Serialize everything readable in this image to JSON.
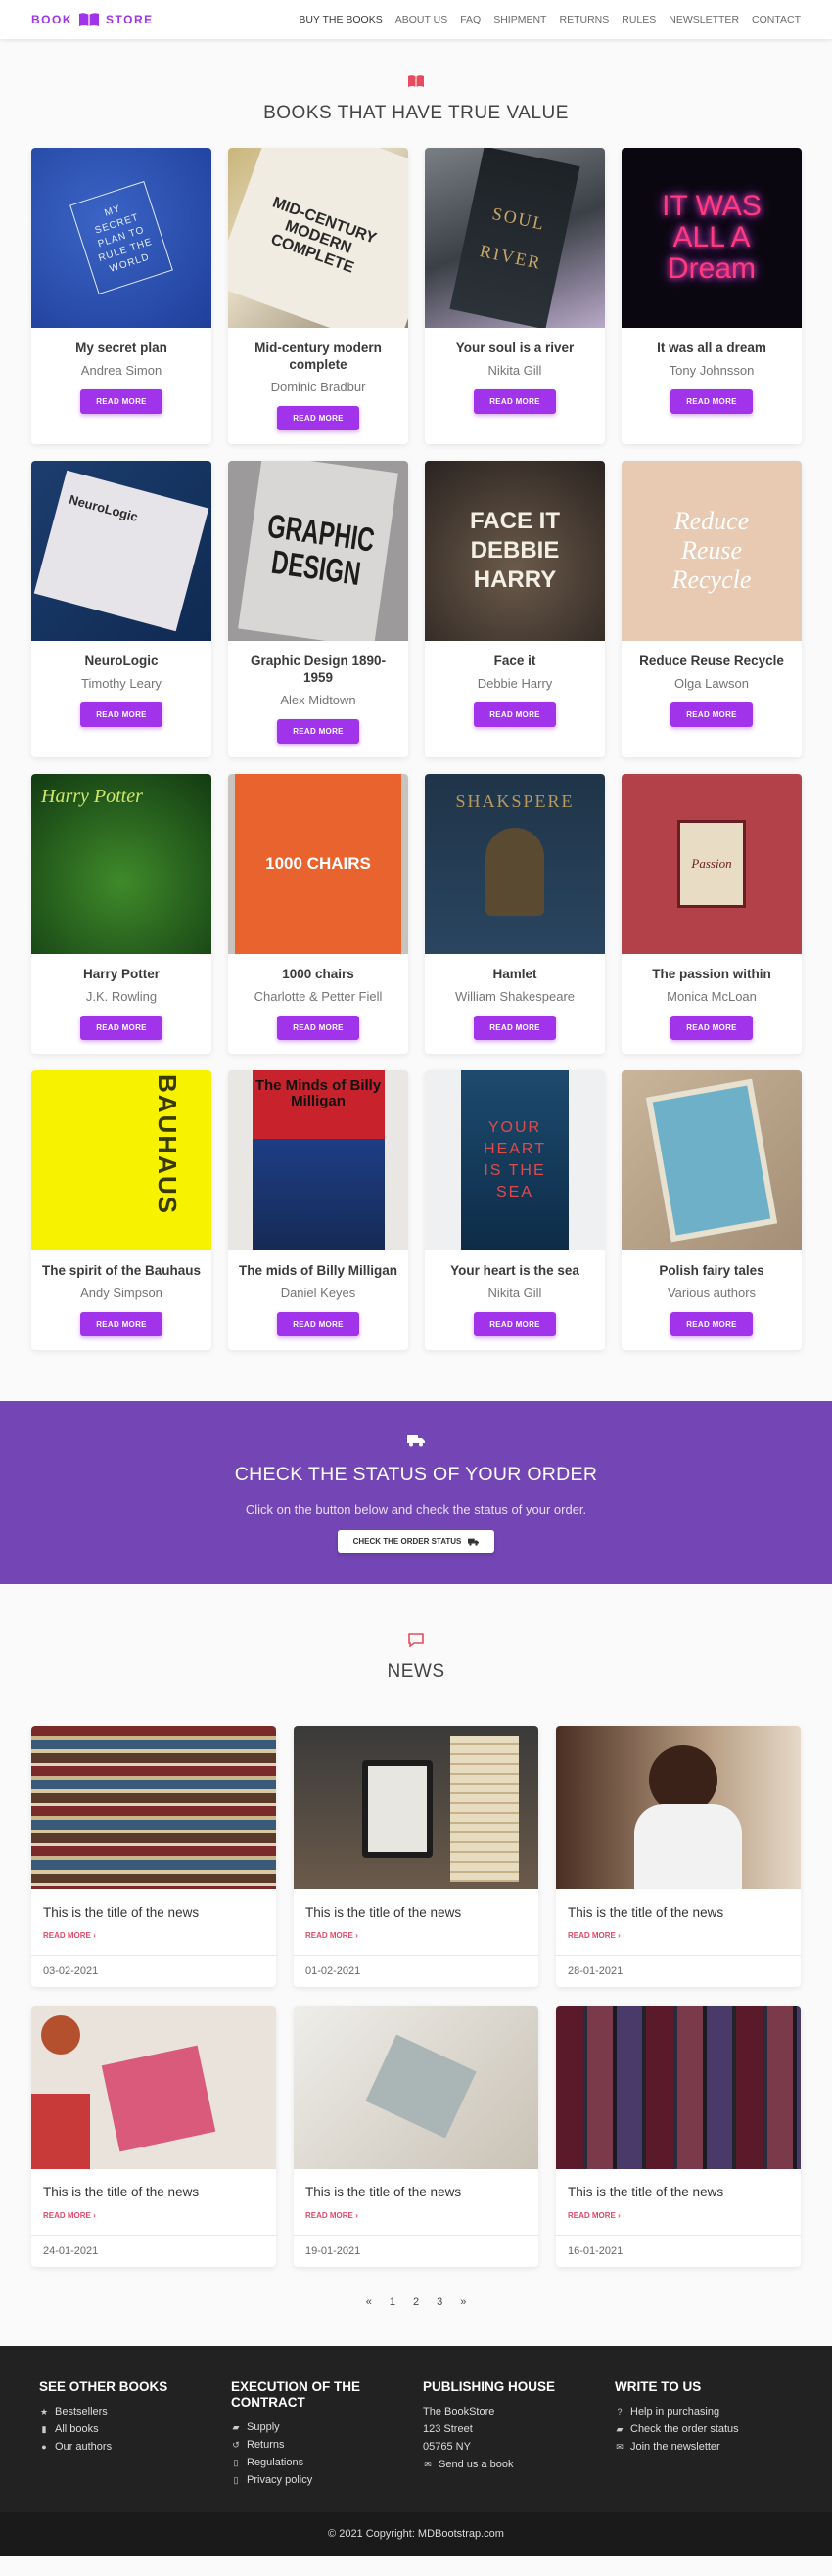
{
  "nav": {
    "brand_left": "BOOK",
    "brand_right": "STORE",
    "items": [
      "BUY THE BOOKS",
      "ABOUT US",
      "FAQ",
      "SHIPMENT",
      "RETURNS",
      "RULES",
      "NEWSLETTER",
      "CONTACT"
    ]
  },
  "books_section": {
    "title": "BOOKS THAT HAVE TRUE VALUE",
    "read_more": "READ MORE",
    "books": [
      {
        "title": "My secret plan",
        "author": "Andrea Simon",
        "cover_text": "MY SECRET PLAN TO RULE THE WORLD"
      },
      {
        "title": "Mid-century modern complete",
        "author": "Dominic Bradbur",
        "cover_text": "MID-CENTURY MODERN COMPLETE"
      },
      {
        "title": "Your soul is a river",
        "author": "Nikita Gill",
        "cover_text": "SOUL RIVER"
      },
      {
        "title": "It was all a dream",
        "author": "Tony Johnsson",
        "cover_text": "IT WAS ALL A Dream"
      },
      {
        "title": "NeuroLogic",
        "author": "Timothy Leary",
        "cover_text": "NeuroLogic"
      },
      {
        "title": "Graphic Design 1890-1959",
        "author": "Alex Midtown",
        "cover_text": "GRAPHIC DESIGN"
      },
      {
        "title": "Face it",
        "author": "Debbie Harry",
        "cover_text": "FACE IT DEBBIE HARRY"
      },
      {
        "title": "Reduce Reuse Recycle",
        "author": "Olga Lawson",
        "cover_text": "Reduce Reuse Recycle"
      },
      {
        "title": "Harry Potter",
        "author": "J.K. Rowling",
        "cover_text": "Harry Potter"
      },
      {
        "title": "1000 chairs",
        "author": "Charlotte & Petter Fiell",
        "cover_text": "1000 CHAIRS"
      },
      {
        "title": "Hamlet",
        "author": "William Shakespeare",
        "cover_text": "SHAKSPERE"
      },
      {
        "title": "The passion within",
        "author": "Monica McLoan",
        "cover_text": "Passion"
      },
      {
        "title": "The spirit of the Bauhaus",
        "author": "Andy Simpson",
        "cover_text": "BAUHAUS"
      },
      {
        "title": "The mids of Billy Milligan",
        "author": "Daniel Keyes",
        "cover_text": "The Minds of Billy Milligan"
      },
      {
        "title": "Your heart is the sea",
        "author": "Nikita Gill",
        "cover_text": "YOUR HEART IS THE SEA"
      },
      {
        "title": "Polish fairy tales",
        "author": "Various authors",
        "cover_text": ""
      }
    ]
  },
  "banner": {
    "title": "CHECK THE STATUS OF YOUR ORDER",
    "text": "Click on the button below and check the status of your order.",
    "button": "CHECK THE ORDER STATUS"
  },
  "news_section": {
    "title": "NEWS",
    "read_more": "READ MORE",
    "items": [
      {
        "title": "This is the title of the news",
        "date": "03-02-2021"
      },
      {
        "title": "This is the title of the news",
        "date": "01-02-2021"
      },
      {
        "title": "This is the title of the news",
        "date": "28-01-2021"
      },
      {
        "title": "This is the title of the news",
        "date": "24-01-2021"
      },
      {
        "title": "This is the title of the news",
        "date": "19-01-2021"
      },
      {
        "title": "This is the title of the news",
        "date": "16-01-2021"
      }
    ]
  },
  "pagination": [
    "«",
    "1",
    "2",
    "3",
    "»"
  ],
  "footer": {
    "columns": [
      {
        "heading": "SEE OTHER BOOKS",
        "links": [
          {
            "icon": "star-icon",
            "label": "Bestsellers"
          },
          {
            "icon": "book-icon",
            "label": "All books"
          },
          {
            "icon": "users-icon",
            "label": "Our authors"
          }
        ]
      },
      {
        "heading": "EXECUTION OF THE CONTRACT",
        "links": [
          {
            "icon": "truck-icon",
            "label": "Supply"
          },
          {
            "icon": "return-icon",
            "label": "Returns"
          },
          {
            "icon": "file-icon",
            "label": "Regulations"
          },
          {
            "icon": "file-icon",
            "label": "Privacy policy"
          }
        ]
      },
      {
        "heading": "PUBLISHING HOUSE",
        "links": [
          {
            "icon": "",
            "label": "The BookStore"
          },
          {
            "icon": "",
            "label": "123 Street"
          },
          {
            "icon": "",
            "label": "05765 NY"
          },
          {
            "icon": "mail-icon",
            "label": "Send us a book"
          }
        ]
      },
      {
        "heading": "WRITE TO US",
        "links": [
          {
            "icon": "help-icon",
            "label": "Help in purchasing"
          },
          {
            "icon": "truck-icon",
            "label": "Check the order status"
          },
          {
            "icon": "mail-icon",
            "label": "Join the newsletter"
          }
        ]
      }
    ],
    "copyright": "© 2021 Copyright: MDBootstrap.com"
  },
  "colors": {
    "accent": "#a133ea",
    "banner": "#7446b5",
    "news_link": "#e34a6a",
    "footer": "#222222"
  }
}
